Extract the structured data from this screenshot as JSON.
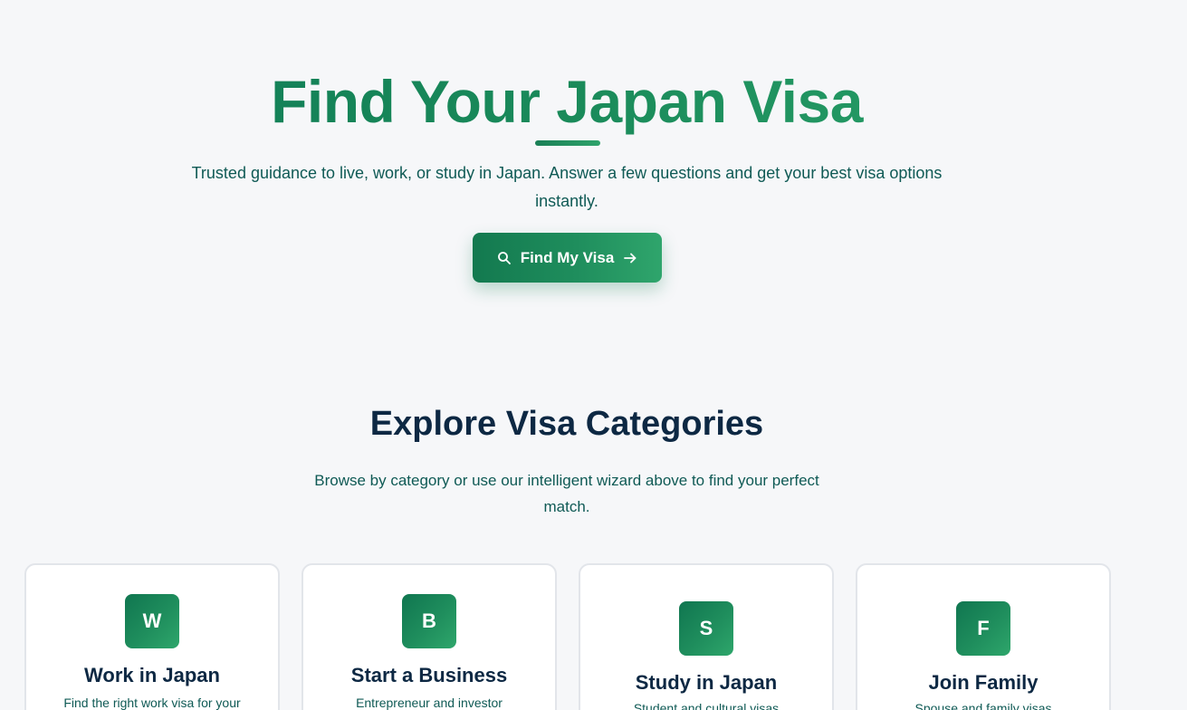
{
  "hero": {
    "title": "Find Your Japan Visa",
    "subtitle": "Trusted guidance to live, work, or study in Japan. Answer a few questions and get your best visa options instantly.",
    "cta_label": "Find My Visa",
    "cta_icon_left": "search-icon",
    "cta_icon_right": "arrow-right-icon"
  },
  "categories": {
    "title": "Explore Visa Categories",
    "subtitle": "Browse by category or use our intelligent wizard above to find your perfect match.",
    "cards": [
      {
        "badge": "W",
        "title": "Work in Japan",
        "description": "Find the right work visa for your"
      },
      {
        "badge": "B",
        "title": "Start a Business",
        "description": "Entrepreneur and investor"
      },
      {
        "badge": "S",
        "title": "Study in Japan",
        "description": "Student and cultural visas"
      },
      {
        "badge": "F",
        "title": "Join Family",
        "description": "Spouse and family visas"
      }
    ]
  },
  "colors": {
    "brand_green": "#1a8a5a",
    "brand_green_light": "#2fa56c",
    "heading_navy": "#0d2843",
    "body_teal": "#0f5a55",
    "background": "#f6f7f9"
  }
}
